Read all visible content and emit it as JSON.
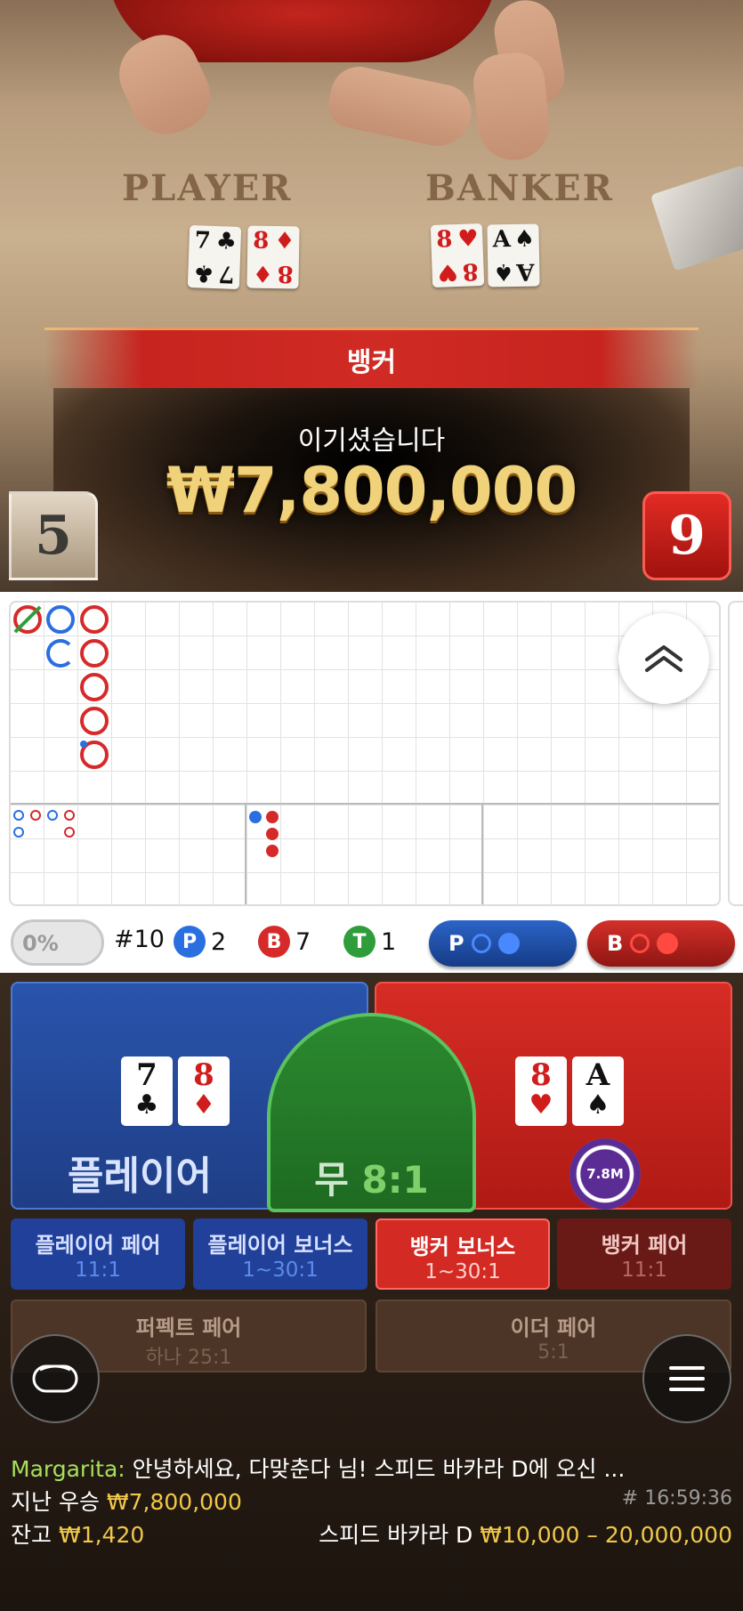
{
  "video": {
    "player_label": "PLAYER",
    "banker_label": "BANKER",
    "player_cards": [
      {
        "rank": "7",
        "suit": "♣",
        "color": "black"
      },
      {
        "rank": "8",
        "suit": "♦",
        "color": "red"
      }
    ],
    "banker_cards": [
      {
        "rank": "8",
        "suit": "♥",
        "color": "red"
      },
      {
        "rank": "A",
        "suit": "♠",
        "color": "black"
      }
    ],
    "result_label": "뱅커",
    "win_message": "이기셨습니다",
    "win_amount": "₩7,800,000",
    "player_score": "5",
    "banker_score": "9"
  },
  "roadmap": {
    "expand_icon": "double-chevron-up-icon",
    "percent_toggle": "0%",
    "round": "#10",
    "player_badge": "P",
    "player_count": "2",
    "banker_badge": "B",
    "banker_count": "7",
    "tie_badge": "T",
    "tie_count": "1",
    "predict_player": "P",
    "predict_banker": "B",
    "colors": {
      "player": "#2a6fe0",
      "banker": "#d62a2a",
      "tie": "#2f9d3a"
    }
  },
  "betting": {
    "player_label": "플레이어",
    "tie_label": "무",
    "tie_odds": "8:1",
    "player_cards": [
      {
        "rank": "7",
        "suit": "♣",
        "color": "black"
      },
      {
        "rank": "8",
        "suit": "♦",
        "color": "red"
      }
    ],
    "banker_cards": [
      {
        "rank": "8",
        "suit": "♥",
        "color": "red"
      },
      {
        "rank": "A",
        "suit": "♠",
        "color": "black"
      }
    ],
    "banker_chip": "7.8M",
    "side_bets": [
      {
        "title": "플레이어 페어",
        "odds": "11:1"
      },
      {
        "title": "플레이어 보너스",
        "odds": "1~30:1"
      },
      {
        "title": "뱅커 보너스",
        "odds": "1~30:1"
      },
      {
        "title": "뱅커 페어",
        "odds": "11:1"
      }
    ],
    "extra_bets": [
      {
        "title": "퍼펙트 페어",
        "odds": "하나 25:1"
      },
      {
        "title": "이더 페어",
        "odds": "5:1"
      }
    ]
  },
  "footer": {
    "chat_name": "Margarita:",
    "chat_message": "안녕하세요, 다맞춘다 님! 스피드 바카라 D에 오신 ...",
    "last_win_label": "지난 우승",
    "last_win_value": "₩7,800,000",
    "time": "# 16:59:36",
    "balance_label": "잔고",
    "balance_value": "₩1,420",
    "table_name": "스피드 바카라 D",
    "table_limits": "₩10,000 – 20,000,000"
  }
}
